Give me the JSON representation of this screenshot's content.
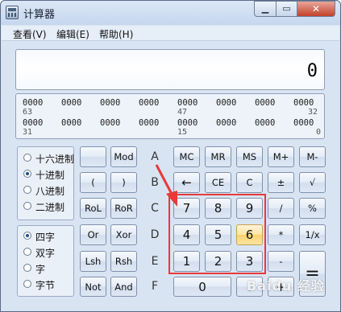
{
  "window": {
    "title": "计算器",
    "minimize": "▁",
    "maximize": "▭",
    "close": "✕"
  },
  "menu": [
    {
      "label": "查看(V)"
    },
    {
      "label": "编辑(E)"
    },
    {
      "label": "帮助(H)"
    }
  ],
  "display": {
    "value": "0"
  },
  "bit_display": {
    "row1": [
      "0000",
      "0000",
      "0000",
      "0000",
      "0000",
      "0000",
      "0000",
      "0000"
    ],
    "row1_labels": [
      "63",
      "47",
      "32"
    ],
    "row2": [
      "0000",
      "0000",
      "0000",
      "0000",
      "0000",
      "0000",
      "0000",
      "0000"
    ],
    "row2_labels": [
      "31",
      "15",
      "0"
    ]
  },
  "base": {
    "options": [
      "十六进制",
      "十进制",
      "八进制",
      "二进制"
    ],
    "selected": "十进制"
  },
  "word": {
    "options": [
      "四字",
      "双字",
      "字",
      "字节"
    ],
    "selected": "四字"
  },
  "keys": {
    "mod": "Mod",
    "A": "A",
    "mc": "MC",
    "mr": "MR",
    "ms": "MS",
    "mplus": "M+",
    "mminus": "M-",
    "lparen": "(",
    "rparen": ")",
    "B": "B",
    "back": "←",
    "ce": "CE",
    "c": "C",
    "plusminus": "±",
    "sqrt": "√",
    "rol": "RoL",
    "ror": "RoR",
    "C": "C",
    "n7": "7",
    "n8": "8",
    "n9": "9",
    "div": "/",
    "pct": "%",
    "or": "Or",
    "xor": "Xor",
    "D": "D",
    "n4": "4",
    "n5": "5",
    "n6": "6",
    "mul": "*",
    "recip": "1/x",
    "lsh": "Lsh",
    "rsh": "Rsh",
    "E": "E",
    "n1": "1",
    "n2": "2",
    "n3": "3",
    "sub": "-",
    "eq": "=",
    "not": "Not",
    "and": "And",
    "F": "F",
    "n0": "0",
    "dot": ".",
    "add": "+"
  },
  "highlight_color": "#e63a3a",
  "watermark": "Baidu 经验"
}
